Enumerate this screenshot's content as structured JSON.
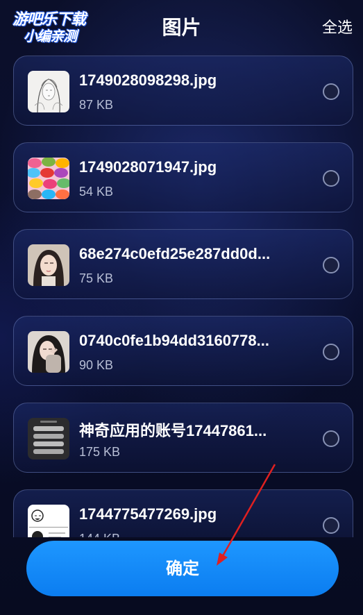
{
  "watermark": {
    "line1": "游吧乐下载",
    "line2": "小编亲测"
  },
  "header": {
    "title": "图片",
    "select_all": "全选"
  },
  "files": [
    {
      "name": "1749028098298.jpg",
      "size": "87 KB",
      "thumb": "sketch-portrait"
    },
    {
      "name": "1749028071947.jpg",
      "size": "54 KB",
      "thumb": "macarons"
    },
    {
      "name": "68e274c0efd25e287dd0d...",
      "size": "75 KB",
      "thumb": "girl-portrait"
    },
    {
      "name": "0740c0fe1b94dd3160778...",
      "size": "90 KB",
      "thumb": "girl-portrait-2"
    },
    {
      "name": "神奇应用的账号17447861...",
      "size": "175 KB",
      "thumb": "app-screenshot"
    },
    {
      "name": "1744775477269.jpg",
      "size": "144 KB",
      "thumb": "meme-comic"
    }
  ],
  "confirm_button": {
    "label": "确定"
  },
  "colors": {
    "accent": "#1e90ff",
    "background": "#0a0f2e"
  }
}
